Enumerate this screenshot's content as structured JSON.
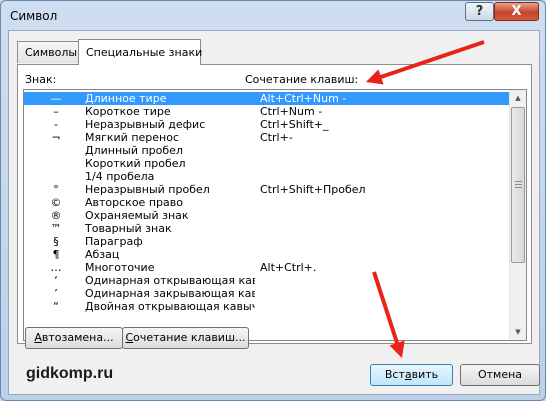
{
  "window": {
    "title": "Символ",
    "help_glyph": "?",
    "close_glyph": "X"
  },
  "tabs": [
    {
      "label": "Символы",
      "active": false
    },
    {
      "label": "Специальные знаки",
      "active": true
    }
  ],
  "list": {
    "header_sign": "Знак:",
    "header_shortcut": "Сочетание клавиш:",
    "selected_index": 0,
    "items": [
      {
        "symbol": "—",
        "name": "Длинное тире",
        "shortcut": "Alt+Ctrl+Num -"
      },
      {
        "symbol": "–",
        "name": "Короткое тире",
        "shortcut": "Ctrl+Num -"
      },
      {
        "symbol": "-",
        "name": "Неразрывный дефис",
        "shortcut": "Ctrl+Shift+_"
      },
      {
        "symbol": "¬",
        "name": "Мягкий перенос",
        "shortcut": "Ctrl+-"
      },
      {
        "symbol": "",
        "name": "Длинный пробел",
        "shortcut": ""
      },
      {
        "symbol": "",
        "name": "Короткий пробел",
        "shortcut": ""
      },
      {
        "symbol": "",
        "name": "1/4 пробела",
        "shortcut": ""
      },
      {
        "symbol": "°",
        "name": "Неразрывный пробел",
        "shortcut": "Ctrl+Shift+Пробел"
      },
      {
        "symbol": "©",
        "name": "Авторское право",
        "shortcut": ""
      },
      {
        "symbol": "®",
        "name": "Охраняемый знак",
        "shortcut": ""
      },
      {
        "symbol": "™",
        "name": "Товарный знак",
        "shortcut": ""
      },
      {
        "symbol": "§",
        "name": "Параграф",
        "shortcut": ""
      },
      {
        "symbol": "¶",
        "name": "Абзац",
        "shortcut": ""
      },
      {
        "symbol": "…",
        "name": "Многоточие",
        "shortcut": "Alt+Ctrl+."
      },
      {
        "symbol": "‘",
        "name": "Одинарная открывающая кавыч...",
        "shortcut": ""
      },
      {
        "symbol": "’",
        "name": "Одинарная закрывающая кавыч...",
        "shortcut": ""
      },
      {
        "symbol": "“",
        "name": "Двойная открывающая кавычка",
        "shortcut": ""
      }
    ]
  },
  "buttons": {
    "autocorrect": {
      "hotkey": "А",
      "rest": "втозамена..."
    },
    "shortcut": {
      "hotkey": "С",
      "rest": "очетание клавиш..."
    },
    "insert": {
      "pre": "Вст",
      "hotkey": "а",
      "rest": "вить"
    },
    "cancel": "Отмена"
  },
  "watermark": "gidkomp.ru",
  "colors": {
    "selection": "#3399ff",
    "arrow": "#e8231a",
    "close_button": "#c7462b"
  }
}
